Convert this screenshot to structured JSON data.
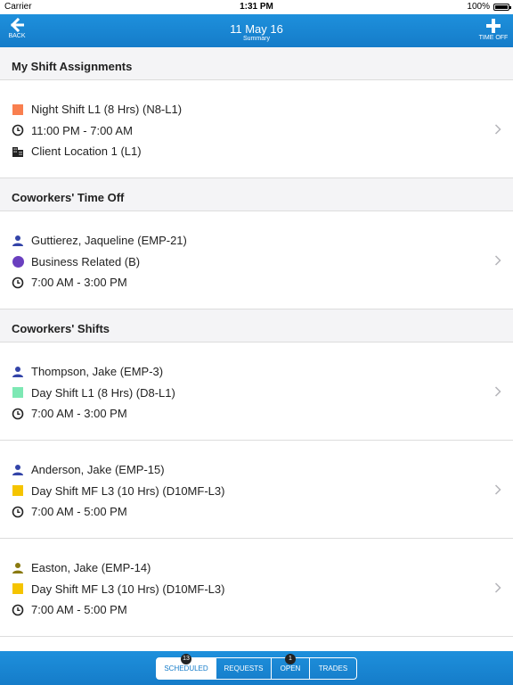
{
  "status_bar": {
    "carrier": "Carrier",
    "time": "1:31 PM",
    "battery": "100%",
    "battery_level": 1.0
  },
  "nav": {
    "back_label": "BACK",
    "title": "11 May 16",
    "subtitle": "Summary",
    "time_off_label": "TIME OFF"
  },
  "sections": {
    "my_shifts": {
      "title": "My Shift Assignments",
      "card": {
        "shift": "Night Shift L1 (8 Hrs) (N8-L1)",
        "shift_color": "#f97f4f",
        "time": "11:00 PM - 7:00 AM",
        "location": "Client Location 1 (L1)"
      }
    },
    "time_off": {
      "title": "Coworkers' Time Off",
      "card": {
        "person": "Guttierez, Jaqueline (EMP-21)",
        "reason": "Business Related (B)",
        "reason_color": "#6a3fbf",
        "time": "7:00 AM - 3:00 PM"
      }
    },
    "coworker_shifts": {
      "title": "Coworkers' Shifts",
      "cards": [
        {
          "person": "Thompson, Jake (EMP-3)",
          "person_color": "#3344a8",
          "shift": "Day Shift L1 (8 Hrs) (D8-L1)",
          "shift_color": "#7de8b4",
          "time": "7:00 AM - 3:00 PM"
        },
        {
          "person": "Anderson, Jake (EMP-15)",
          "person_color": "#3344a8",
          "shift": "Day Shift MF L3 (10 Hrs) (D10MF-L3)",
          "shift_color": "#f5c400",
          "time": "7:00 AM - 5:00 PM"
        },
        {
          "person": "Easton, Jake (EMP-14)",
          "person_color": "#8a7a10",
          "shift": "Day Shift MF L3 (10 Hrs) (D10MF-L3)",
          "shift_color": "#f5c400",
          "time": "7:00 AM - 5:00 PM"
        }
      ]
    }
  },
  "tabs": [
    {
      "label": "SCHEDULED",
      "badge": "13",
      "active": true
    },
    {
      "label": "REQUESTS",
      "badge": "",
      "active": false
    },
    {
      "label": "OPEN",
      "badge": "1",
      "active": false
    },
    {
      "label": "TRADES",
      "badge": "",
      "active": false
    }
  ],
  "colors": {
    "accent": "#1a86d2",
    "person_icon": "#3344a8"
  }
}
